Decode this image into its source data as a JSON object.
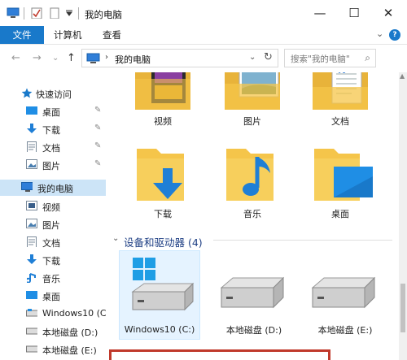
{
  "window": {
    "title": "我的电脑",
    "controls": {
      "minimize": "—",
      "maximize": "☐",
      "close": "✕"
    }
  },
  "ribbon": {
    "file_tab": "文件",
    "tabs": [
      "计算机",
      "查看"
    ],
    "expand": "⌄",
    "help": "?"
  },
  "address": {
    "back": "←",
    "forward": "→",
    "recent": "⌄",
    "up": "↑",
    "chevron": "›",
    "path": "我的电脑",
    "dropdown": "⌄",
    "refresh": "↻",
    "search_placeholder": "搜索\"我的电脑\"",
    "search_icon": "⌕"
  },
  "sidebar": {
    "quick_access": {
      "label": "快速访问",
      "icon": "star-icon"
    },
    "pinned": [
      {
        "label": "桌面",
        "icon": "desktop-icon",
        "pin": "📌"
      },
      {
        "label": "下载",
        "icon": "download-icon",
        "pin": "📌"
      },
      {
        "label": "文档",
        "icon": "document-icon",
        "pin": "📌"
      },
      {
        "label": "图片",
        "icon": "picture-icon",
        "pin": "📌"
      }
    ],
    "this_pc": {
      "label": "我的电脑",
      "icon": "computer-icon"
    },
    "pc_items": [
      {
        "label": "视频",
        "icon": "video-icon"
      },
      {
        "label": "图片",
        "icon": "picture-icon"
      },
      {
        "label": "文档",
        "icon": "document-icon"
      },
      {
        "label": "下载",
        "icon": "download-icon"
      },
      {
        "label": "音乐",
        "icon": "music-icon"
      },
      {
        "label": "桌面",
        "icon": "desktop-icon"
      },
      {
        "label": "Windows10 (C",
        "icon": "drive-icon"
      },
      {
        "label": "本地磁盘 (D:)",
        "icon": "drive-icon"
      },
      {
        "label": "本地磁盘 (E:)",
        "icon": "drive-icon"
      }
    ]
  },
  "folders": [
    {
      "label": "视频",
      "icon": "video-folder-icon"
    },
    {
      "label": "图片",
      "icon": "picture-folder-icon"
    },
    {
      "label": "文档",
      "icon": "document-folder-icon"
    },
    {
      "label": "下载",
      "icon": "download-folder-icon"
    },
    {
      "label": "音乐",
      "icon": "music-folder-icon"
    },
    {
      "label": "桌面",
      "icon": "desktop-folder-icon"
    }
  ],
  "devices": {
    "header": "设备和驱动器 (4)",
    "collapse": "⌄",
    "drives": [
      {
        "label": "Windows10 (C:)",
        "icon": "system-drive-icon",
        "selected": true
      },
      {
        "label": "本地磁盘 (D:)",
        "icon": "drive-icon",
        "selected": false
      },
      {
        "label": "本地磁盘 (E:)",
        "icon": "drive-icon",
        "selected": false
      }
    ]
  },
  "colors": {
    "accent": "#1979ca",
    "selection": "#cce4f7",
    "folder": "#f5c54a",
    "highlight_box": "#c0392b"
  }
}
